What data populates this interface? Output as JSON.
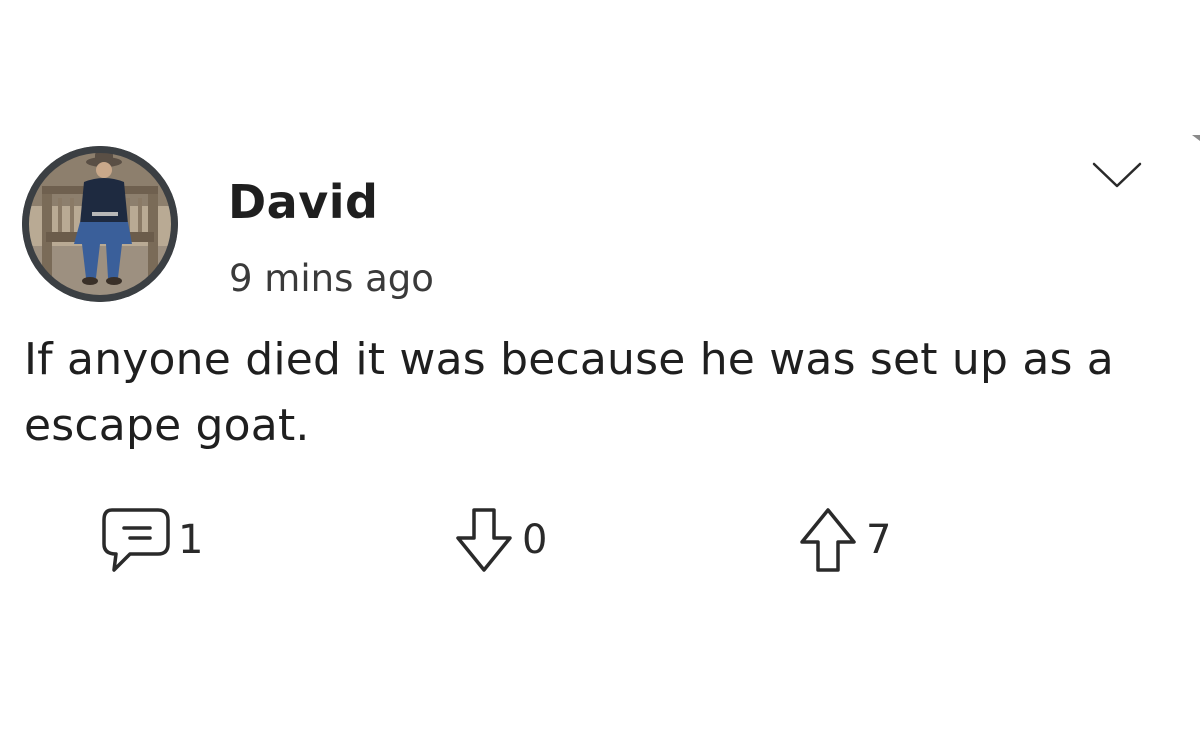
{
  "comment": {
    "author": "David",
    "timestamp": "9 mins ago",
    "text": "If anyone died it was because he was set up as a escape goat.",
    "avatar_icon": "profile-photo",
    "menu_icon": "chevron-down-icon"
  },
  "actions": {
    "reply_count": "1",
    "downvote_count": "0",
    "upvote_count": "7",
    "reply_icon": "comment-bubble-icon",
    "downvote_icon": "arrow-down-icon",
    "upvote_icon": "arrow-up-icon"
  },
  "colors": {
    "text": "#1f1f1f",
    "icon_stroke": "#2a2a2a",
    "background": "#ffffff"
  }
}
